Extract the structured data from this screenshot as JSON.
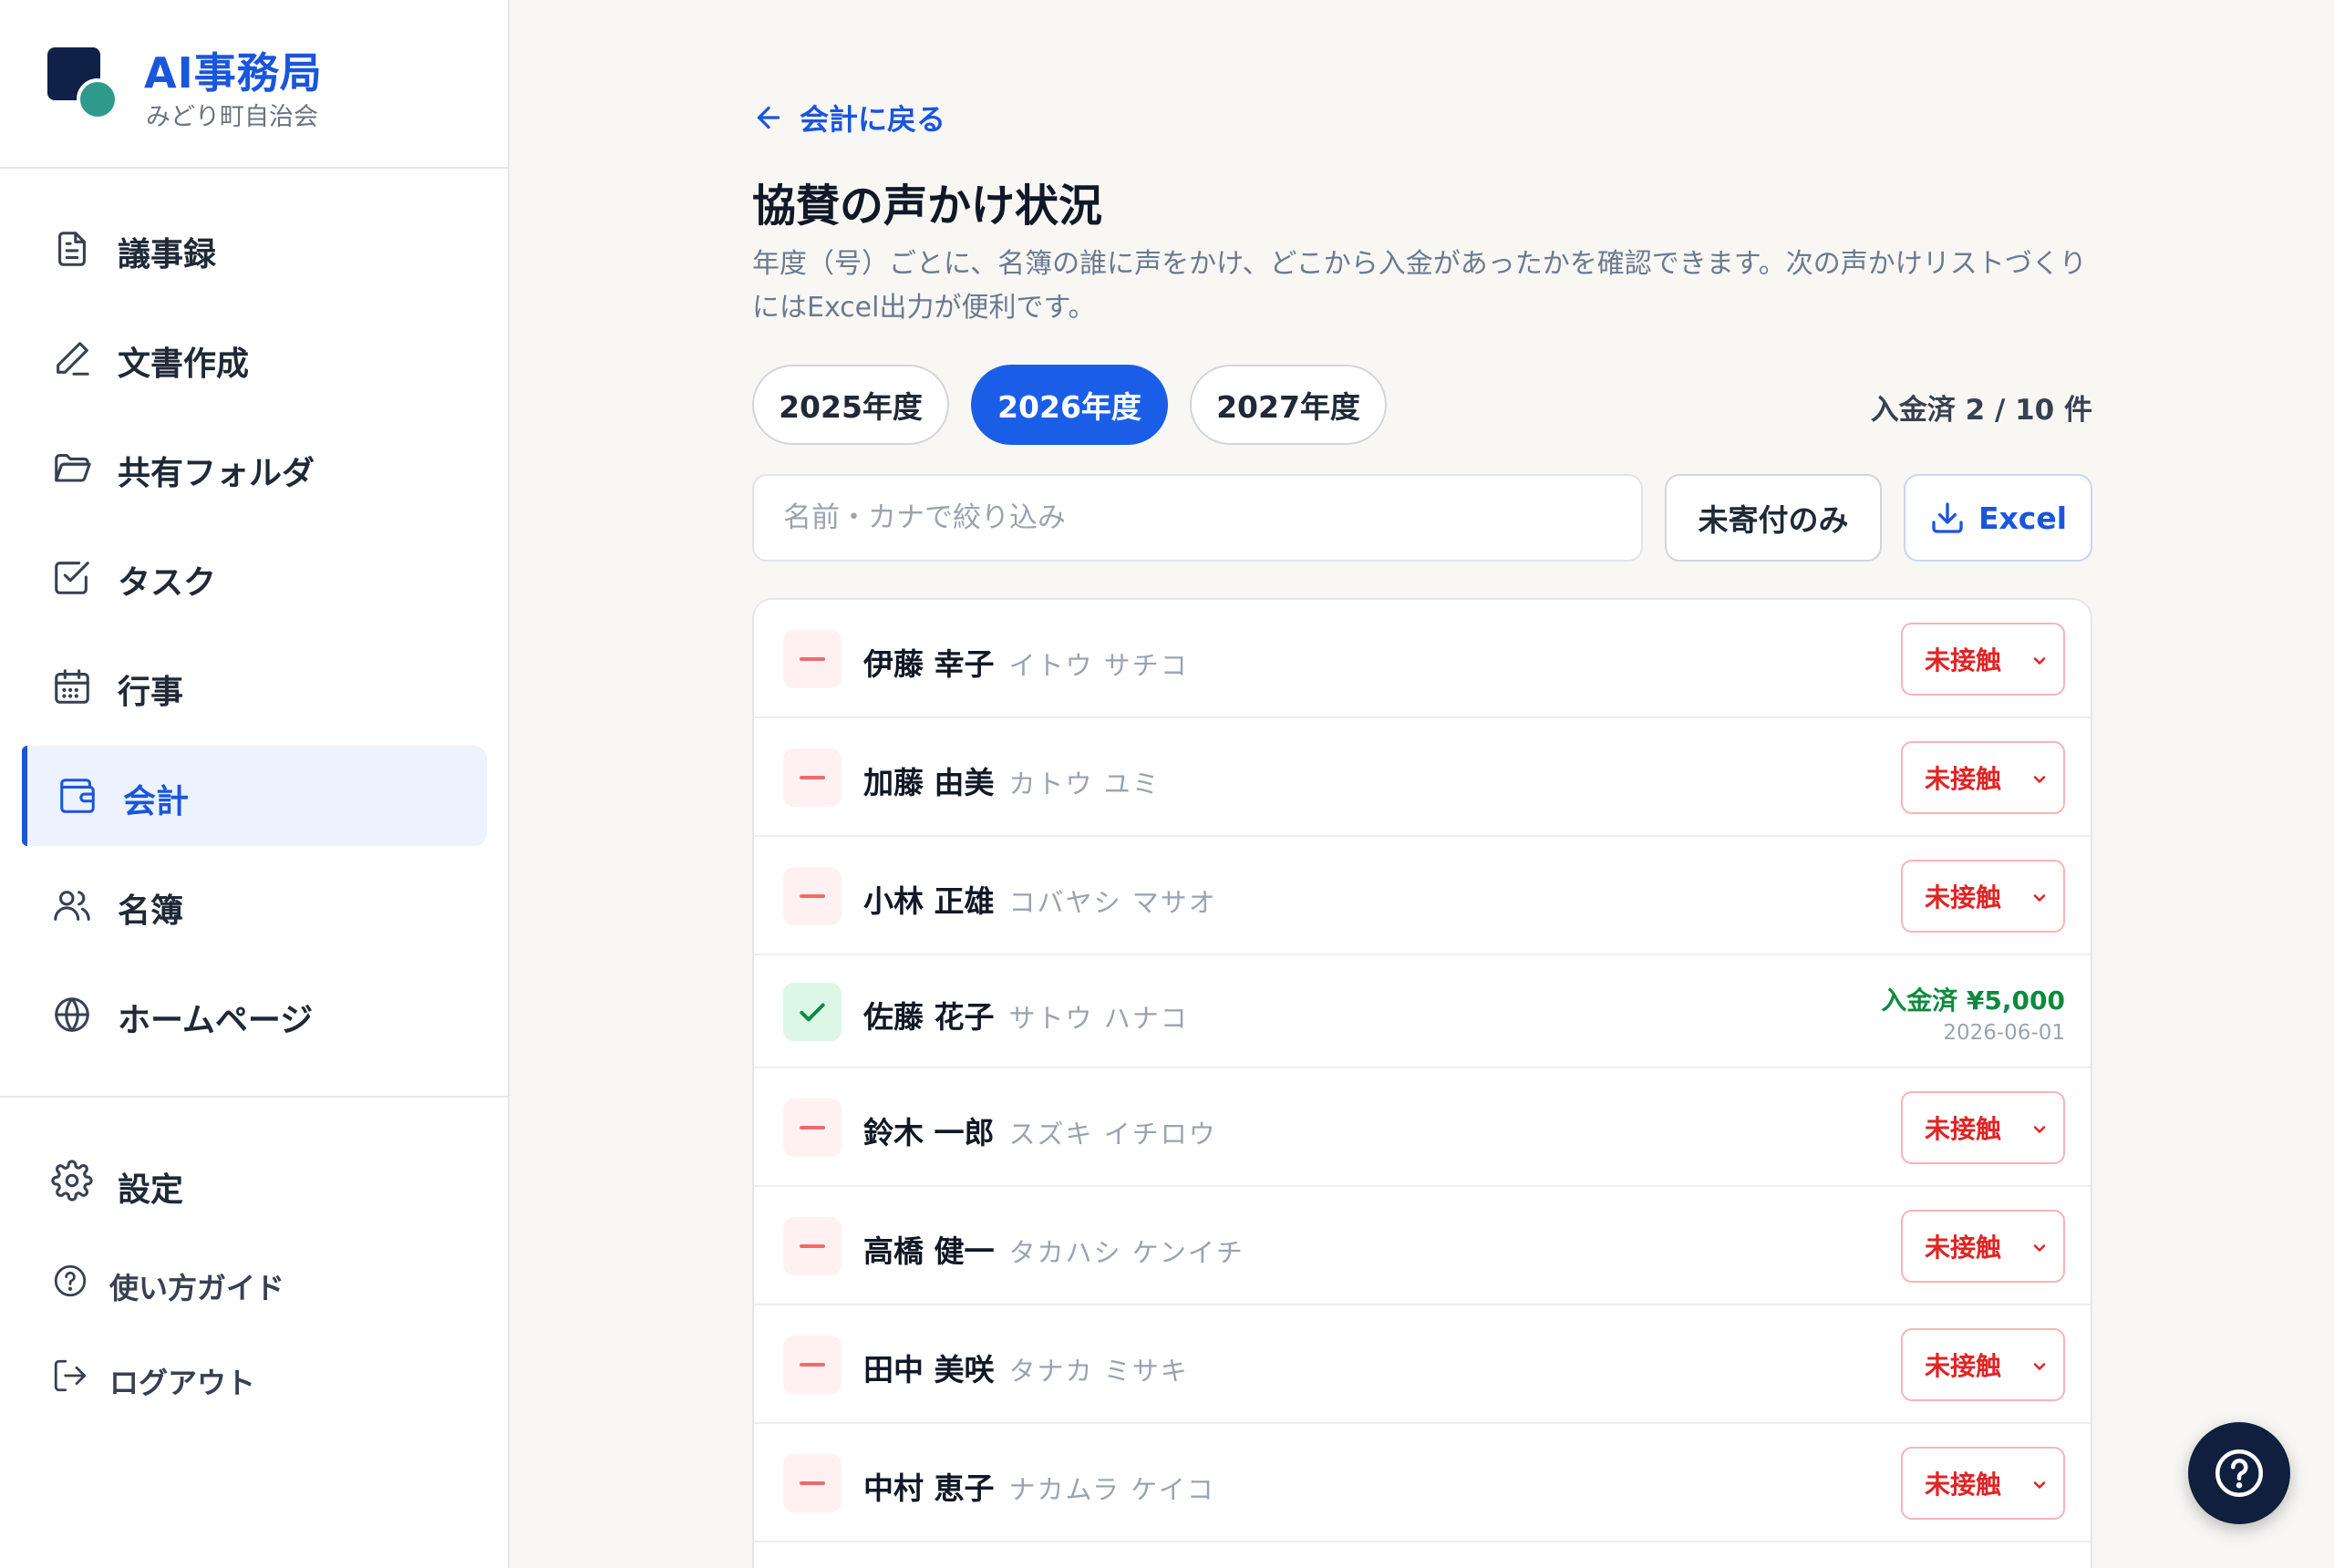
{
  "brand": {
    "title": "AI事務局",
    "subtitle": "みどり町自治会"
  },
  "sidebar": {
    "items": [
      {
        "label": "議事録",
        "icon": "document-icon"
      },
      {
        "label": "文書作成",
        "icon": "pen-icon"
      },
      {
        "label": "共有フォルダ",
        "icon": "folder-icon"
      },
      {
        "label": "タスク",
        "icon": "checkbox-icon"
      },
      {
        "label": "行事",
        "icon": "calendar-icon"
      },
      {
        "label": "会計",
        "icon": "wallet-icon",
        "active": true
      },
      {
        "label": "名簿",
        "icon": "users-icon"
      },
      {
        "label": "ホームページ",
        "icon": "globe-icon"
      }
    ],
    "footer": [
      {
        "label": "設定",
        "icon": "gear-icon"
      },
      {
        "label": "使い方ガイド",
        "icon": "help-circle-icon"
      },
      {
        "label": "ログアウト",
        "icon": "logout-icon"
      }
    ]
  },
  "main": {
    "back_label": "会計に戻る",
    "title": "協賛の声かけ状況",
    "description": "年度（号）ごとに、名簿の誰に声をかけ、どこから入金があったかを確認できます。次の声かけリストづくりにはExcel出力が便利です。",
    "year_tabs": [
      {
        "label": "2025年度",
        "active": false
      },
      {
        "label": "2026年度",
        "active": true
      },
      {
        "label": "2027年度",
        "active": false
      }
    ],
    "paid_count": "入金済 2 / 10 件",
    "search": {
      "placeholder": "名前・カナで絞り込み",
      "value": ""
    },
    "unpaid_only_label": "未寄付のみ",
    "excel_label": "Excel",
    "rows": [
      {
        "name": "伊藤 幸子",
        "kana": "イトウ サチコ",
        "status": "未接触"
      },
      {
        "name": "加藤 由美",
        "kana": "カトウ ユミ",
        "status": "未接触"
      },
      {
        "name": "小林 正雄",
        "kana": "コバヤシ マサオ",
        "status": "未接触"
      },
      {
        "name": "佐藤 花子",
        "kana": "サトウ ハナコ",
        "paid": "入金済 ¥5,000",
        "date": "2026-06-01"
      },
      {
        "name": "鈴木 一郎",
        "kana": "スズキ イチロウ",
        "status": "未接触"
      },
      {
        "name": "高橋 健一",
        "kana": "タカハシ ケンイチ",
        "status": "未接触"
      },
      {
        "name": "田中 美咲",
        "kana": "タナカ ミサキ",
        "status": "未接触"
      },
      {
        "name": "中村 恵子",
        "kana": "ナカムラ ケイコ",
        "status": "未接触"
      }
    ]
  },
  "colors": {
    "accent": "#1a56db",
    "unpaid_status": "#e02424",
    "paid_status": "#0e8a3e",
    "logo_dark": "#0f2147",
    "logo_teal": "#2f9a8c"
  }
}
